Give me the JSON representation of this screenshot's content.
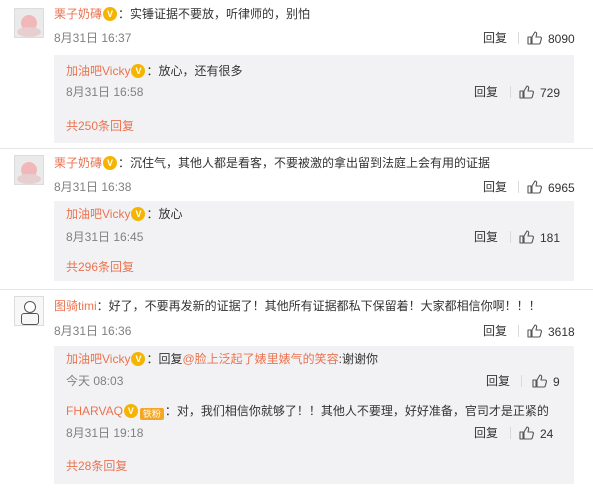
{
  "comments": [
    {
      "user": "栗子奶磚",
      "text": "：实锤证据不要放，听律师的，别怕",
      "time": "8月31日 16:37",
      "reply": "回复",
      "likes": "8090",
      "subreplies": [
        {
          "user": "加油吧Vicky",
          "text": "：放心，还有很多",
          "time": "8月31日 16:58",
          "reply": "回复",
          "likes": "729"
        }
      ],
      "more": "共250条回复"
    },
    {
      "user": "栗子奶磚",
      "text": "：沉住气，其他人都是看客，不要被激的拿出留到法庭上会有用的证据",
      "time": "8月31日 16:38",
      "reply": "回复",
      "likes": "6965",
      "subreplies": [
        {
          "user": "加油吧Vicky",
          "text": "：放心",
          "time": "8月31日 16:45",
          "reply": "回复",
          "likes": "181"
        }
      ],
      "more": "共296条回复"
    },
    {
      "user": "图骑timi",
      "text": "：好了，不要再发新的证据了！其他所有证据都私下保留着！大家都相信你啊！！！",
      "time": "8月31日 16:36",
      "reply": "回复",
      "likes": "3618",
      "subreplies": [
        {
          "user": "加油吧Vicky",
          "text_prefix": "：回复",
          "mention": "@脸上泛起了婊里婊气的笑容",
          "text_suffix": ":谢谢你",
          "time": "今天 08:03",
          "reply": "回复",
          "likes": "9"
        },
        {
          "user": "FHARVAQ",
          "badge": "铁粉",
          "text": "：对，我们相信你就够了！！其他人不要理，好好准备，官司才是正紧的",
          "time": "8月31日 19:18",
          "reply": "回复",
          "likes": "24"
        }
      ],
      "more": "共28条回复"
    }
  ],
  "icons": {
    "like": "thumbs-up-icon",
    "verified": "vip-badge-icon"
  },
  "colors": {
    "username": "#eb7350",
    "subbox_bg": "#f2f2f5",
    "time": "#808080"
  }
}
